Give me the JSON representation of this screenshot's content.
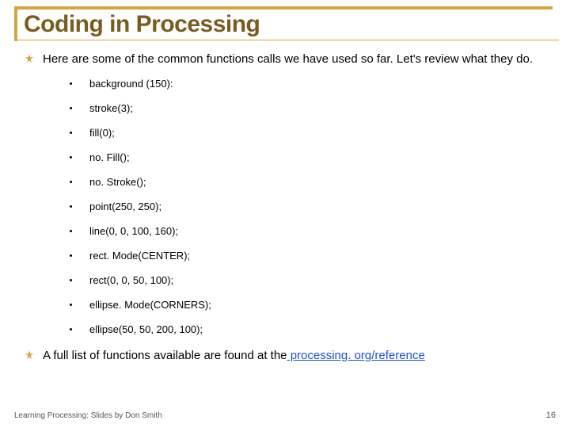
{
  "title": "Coding in Processing",
  "intro": "Here are some of the common functions calls we have used so far. Let's review what they do.",
  "functions": [
    "background (150):",
    "stroke(3);",
    "fill(0);",
    "no. Fill();",
    "no. Stroke();",
    "point(250, 250);",
    "line(0, 0, 100, 160);",
    "rect. Mode(CENTER);",
    "rect(0, 0, 50, 100);",
    "ellipse. Mode(CORNERS);",
    "ellipse(50, 50, 200, 100);"
  ],
  "closing_prefix": "A full list of functions available are found at the",
  "closing_link": " processing. org/reference",
  "footer_text": "Learning Processing: Slides by Don Smith",
  "page_number": "16"
}
